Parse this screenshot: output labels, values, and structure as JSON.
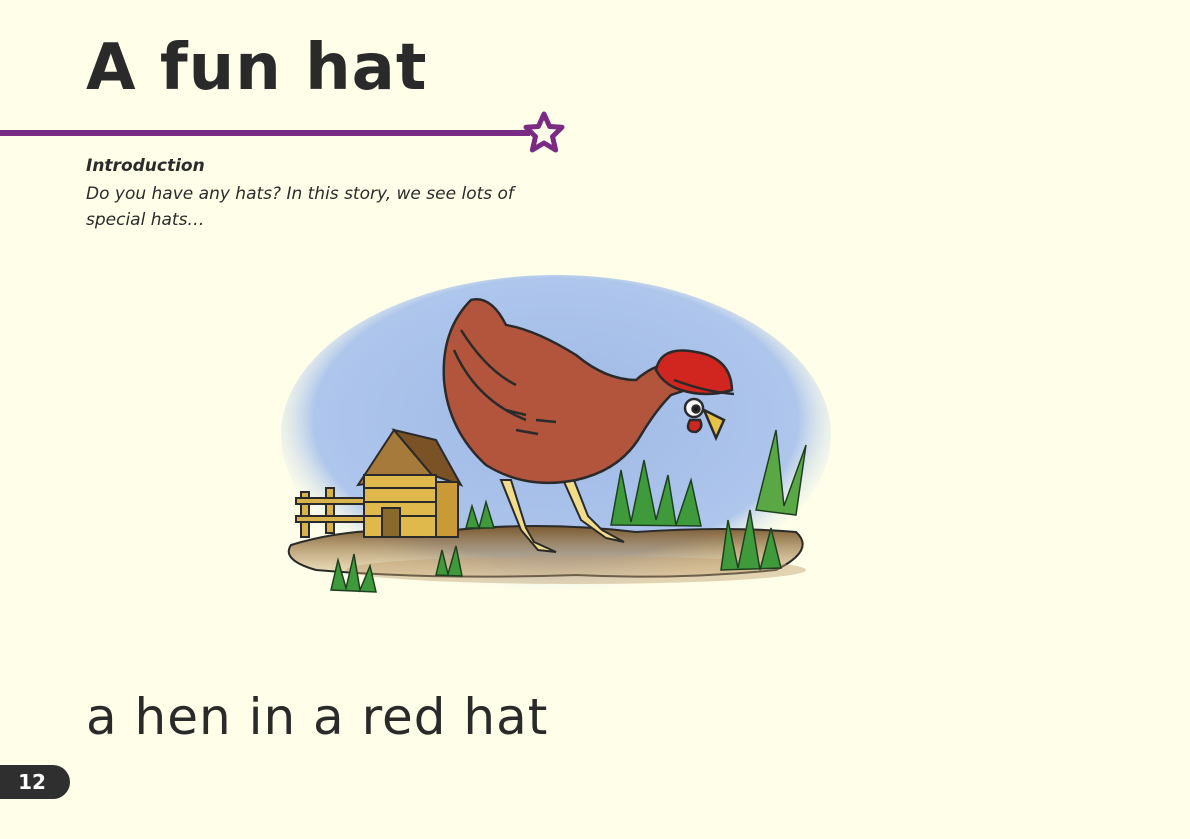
{
  "page": {
    "title": "A fun hat",
    "introduction": {
      "heading": "Introduction",
      "text": "Do you have any hats? In this story, we see lots of special hats…"
    },
    "story_line": "a hen in a red hat",
    "page_number": "12"
  },
  "colors": {
    "background": "#fefee9",
    "accent_purple": "#7b2a83",
    "sky": "#a9c2ea",
    "hen": "#b2553c",
    "hat": "#d1261f"
  },
  "illustration": {
    "subject": "hen-wearing-red-hat",
    "elements": [
      "wooden-hut-icon",
      "fence-icon",
      "grass-icon",
      "hen-icon",
      "red-hat-icon"
    ]
  }
}
